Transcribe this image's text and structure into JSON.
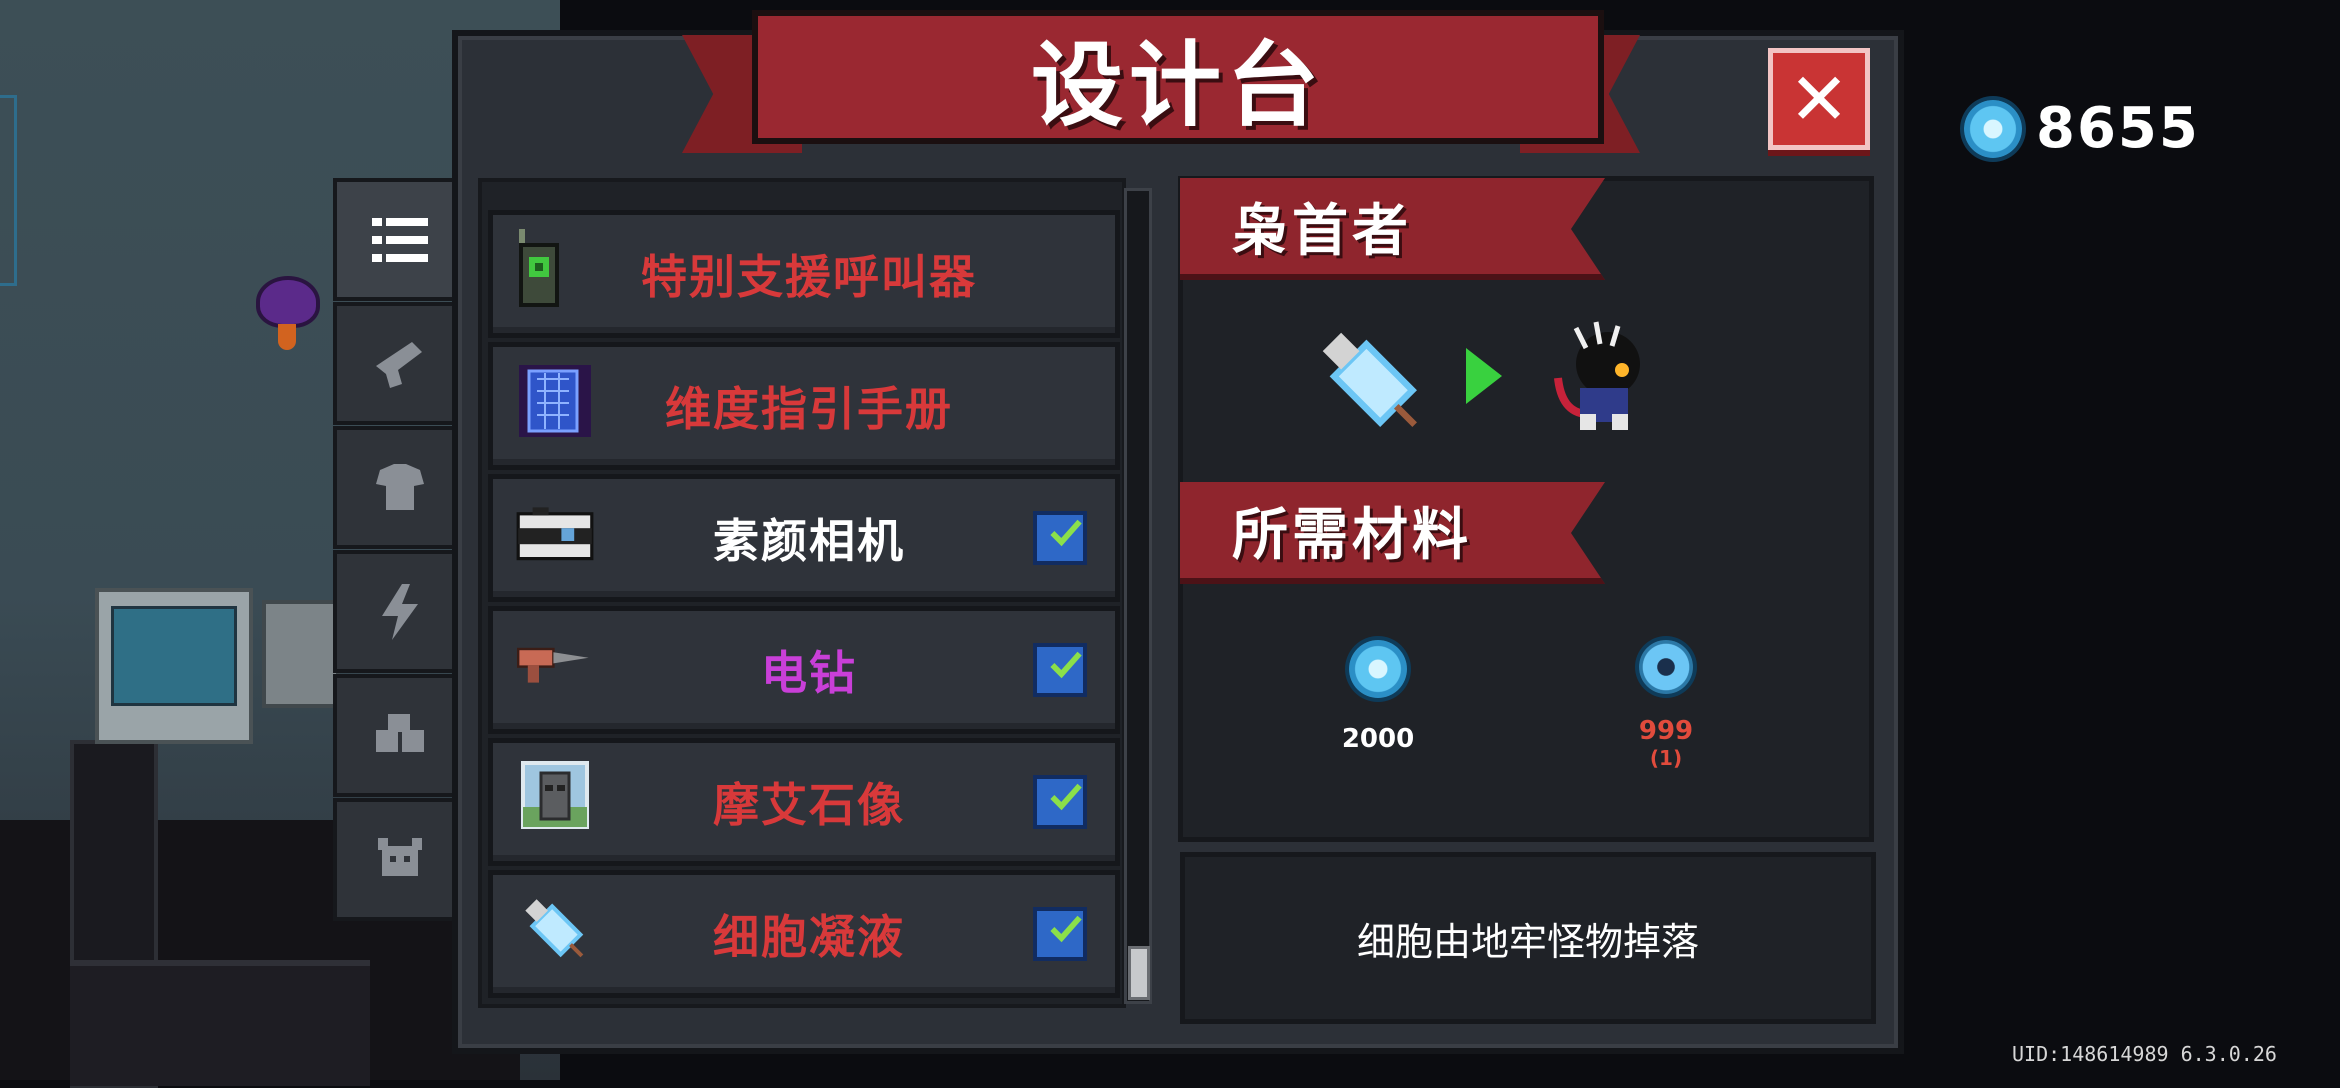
{
  "window": {
    "title": "设计台",
    "close_label": "✕"
  },
  "currency": {
    "icon": "blue-gem-icon",
    "amount": "8655"
  },
  "tabs": [
    {
      "icon": "list-icon",
      "active": true
    },
    {
      "icon": "gun-icon",
      "active": false
    },
    {
      "icon": "armor-icon",
      "active": false
    },
    {
      "icon": "lightning-icon",
      "active": false
    },
    {
      "icon": "materials-icon",
      "active": false
    },
    {
      "icon": "pet-icon",
      "active": false
    }
  ],
  "blueprints": [
    {
      "name": "特别支援呼叫器",
      "color": "#d8393a",
      "icon": "walkie-talkie-icon",
      "unlocked": false
    },
    {
      "name": "维度指引手册",
      "color": "#d8393a",
      "icon": "dimension-manual-icon",
      "unlocked": false
    },
    {
      "name": "素颜相机",
      "color": "#ffffff",
      "icon": "camera-icon",
      "unlocked": true
    },
    {
      "name": "电钻",
      "color": "#c93fd8",
      "icon": "drill-icon",
      "unlocked": true
    },
    {
      "name": "摩艾石像",
      "color": "#d8393a",
      "icon": "moai-statue-icon",
      "unlocked": true
    },
    {
      "name": "细胞凝液",
      "color": "#d8393a",
      "icon": "cell-syringe-icon",
      "unlocked": true
    }
  ],
  "detail": {
    "target_title": "枭首者",
    "conversion": {
      "from_icon": "cell-syringe-icon",
      "arrow_icon": "green-arrow-icon",
      "to_icon": "beheader-character-icon"
    },
    "materials_title": "所需材料",
    "materials": [
      {
        "icon": "blue-gem-icon",
        "amount": "2000",
        "owned": "",
        "color": "#ffffff"
      },
      {
        "icon": "cell-material-icon",
        "amount": "999",
        "owned": "(1)",
        "color": "#e14b3c"
      }
    ],
    "description": "细胞由地牢怪物掉落"
  },
  "footer": {
    "uid": "UID:148614989 6.3.0.26"
  }
}
